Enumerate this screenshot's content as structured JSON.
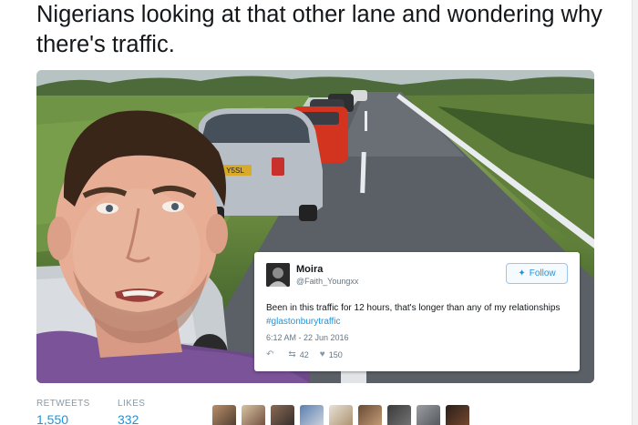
{
  "caption": "Nigerians looking at that other lane and wondering why there's traffic.",
  "embedded_tweet": {
    "display_name": "Moira",
    "handle": "@Faith_Youngxx",
    "follow_label": "Follow",
    "text": "Been in this traffic for 12 hours, that's longer than any of my relationships ",
    "hashtag": "#glastonburytraffic",
    "timestamp": "6:12 AM - 22 Jun 2016",
    "retweet_count": "42",
    "like_count": "150"
  },
  "car_plate": "Y5SL",
  "stats": {
    "retweets_label": "RETWEETS",
    "retweets_value": "1,550",
    "likes_label": "LIKES",
    "likes_value": "332"
  },
  "colors": {
    "twitter_blue": "#1b95e0",
    "text_gray": "#657786"
  }
}
